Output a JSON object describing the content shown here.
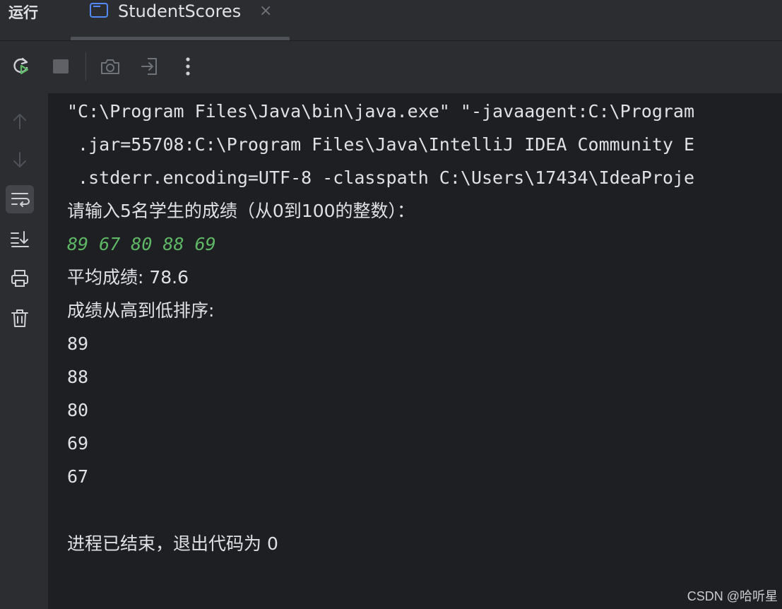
{
  "header": {
    "run_label": "运行",
    "tab": {
      "label": "StudentScores",
      "close": "×"
    }
  },
  "toolbar": {
    "icons": [
      "rerun-icon",
      "stop-icon",
      "camera-icon",
      "exit-icon",
      "more-icon"
    ]
  },
  "gutter": {
    "icons": [
      "arrow-up-icon",
      "arrow-down-icon",
      "soft-wrap-icon",
      "scroll-to-end-icon",
      "print-icon",
      "trash-icon"
    ]
  },
  "console": {
    "lines": [
      "\"C:\\Program Files\\Java\\bin\\java.exe\" \"-javaagent:C:\\Program",
      " .jar=55708:C:\\Program Files\\Java\\IntelliJ IDEA Community E",
      " .stderr.encoding=UTF-8 -classpath C:\\Users\\17434\\IdeaProje",
      "请输入5名学生的成绩（从0到100的整数）：",
      "89 67 80 88 69",
      "平均成绩: 78.6",
      "成绩从高到低排序:",
      "89",
      "88",
      "80",
      "69",
      "67",
      "进程已结束，退出代码为 0"
    ]
  },
  "watermark": "CSDN @哈听星",
  "colors": {
    "background": "#1e1f22",
    "panel": "#2b2d30",
    "text": "#dfe1e5",
    "user_input": "#5fb865",
    "accent": "#548af7"
  }
}
